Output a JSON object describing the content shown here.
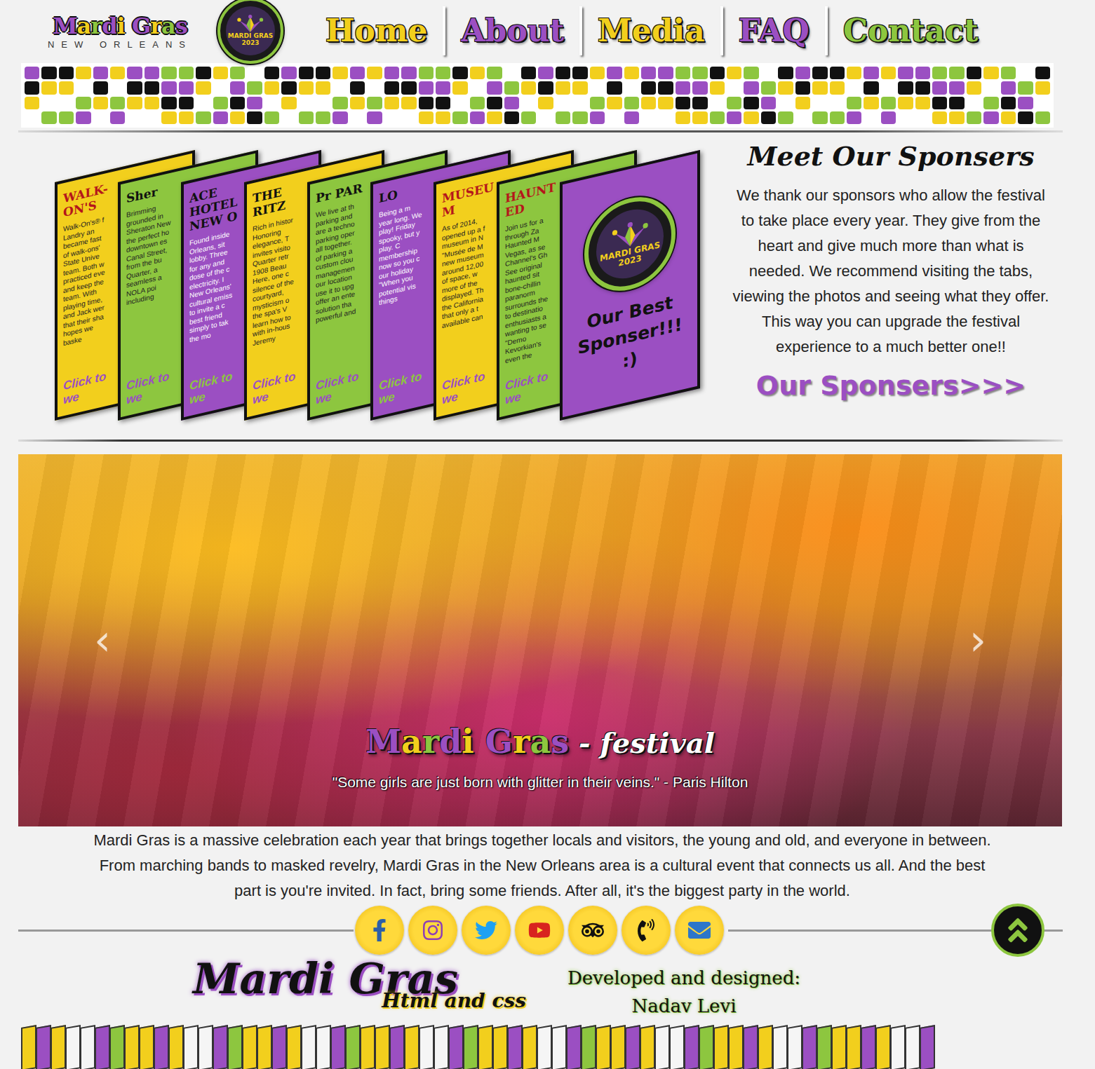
{
  "header": {
    "logo": {
      "title": "Mardi Gras",
      "subtitle": "NEW ORLEANS"
    },
    "badge": {
      "line1": "MARDI GRAS",
      "line2": "2023"
    },
    "nav": [
      {
        "label": "Home",
        "selected": false
      },
      {
        "label": "About",
        "selected": false
      },
      {
        "label": "Media",
        "selected": false
      },
      {
        "label": "FAQ",
        "selected": false
      },
      {
        "label": "Contact",
        "selected": false
      }
    ]
  },
  "sponsors": {
    "title": "Meet Our Sponsers",
    "description": "We thank our sponsors who allow the festival to take place every year. They give from the heart and give much more than what is needed. We recommend visiting the tabs, viewing the photos and seeing what they offer. This way you can upgrade the festival experience to a much better one!!",
    "link": "Our Sponsers>>>",
    "cards": [
      {
        "title": "WALK-ON'S",
        "color": "#f2cf1d",
        "lines": [
          "Walk-On's® f",
          "Landry an",
          "became fast",
          "of walk-ons'",
          "State Unive",
          "team. Both w",
          "practiced eve",
          "and keep the",
          "team. With",
          "playing time,",
          "and Jack wer",
          "that their sha",
          "hopes we",
          "baske"
        ],
        "cta": [
          "Click to",
          "we"
        ]
      },
      {
        "title": "Sher",
        "color": "#8dc63f",
        "lines": [
          "Brimming",
          "grounded in",
          "Sheraton New",
          "the perfect ho",
          "downtown es",
          "Canal Street,",
          "from the bu",
          "Quarter, a",
          "seamless a",
          "NOLA poi",
          "including"
        ],
        "cta": [
          "Click to",
          "we"
        ]
      },
      {
        "title": "ACE HOTEL NEW O",
        "color": "#9b4fc2",
        "lines": [
          "Found inside",
          "Orleans, sit",
          "lobby. Three",
          "for any and",
          "dose of the c",
          "electricity. I",
          "New Orleans'",
          "cultural emiss",
          "to invite a c",
          "best friend",
          "simply to tak",
          "the mo"
        ],
        "cta": [
          "Click to",
          "we"
        ]
      },
      {
        "title": "THE RITZ",
        "color": "#f2cf1d",
        "lines": [
          "Rich in histor",
          "Honoring",
          "elegance, T",
          "invites visito",
          "Quarter retr",
          "1908 Beau",
          "Here, one c",
          "silence of the",
          "courtyard,",
          "mysticism o",
          "the spa's V",
          "learn how to",
          "with in-hous",
          "Jeremy"
        ],
        "cta": [
          "Click to",
          "we"
        ]
      },
      {
        "title": "Pr PAR",
        "color": "#8dc63f",
        "lines": [
          "We live at th",
          "parking and",
          "are a techno",
          "parking oper",
          "all together.",
          "of parking a",
          "custom clou",
          "managemen",
          "our location",
          "use it to upg",
          "offer an ente",
          "solution tha",
          "powerful and"
        ],
        "cta": [
          "Click to",
          "we"
        ]
      },
      {
        "title": "LO",
        "color": "#9b4fc2",
        "lines": [
          "Being a m",
          "year long. We",
          "play! Friday",
          "spooky, but y",
          "play. C",
          "membership",
          "now so you c",
          "our holiday",
          "\"When you",
          "potential vis",
          "things"
        ],
        "cta": [
          "Click to",
          "we"
        ]
      },
      {
        "title": "MUSEUM",
        "color": "#f2cf1d",
        "lines": [
          "As of 2014,",
          "opened up a f",
          "museum in N",
          "\"Musée de M",
          "new museum",
          "around 12,00",
          "of space, w",
          "more of the",
          "displayed. Th",
          "the California",
          "that only a t",
          "available can"
        ],
        "cta": [
          "Click to",
          "we"
        ]
      },
      {
        "title": "HAUNTED",
        "color": "#8dc63f",
        "lines": [
          "Join us for a",
          "through Za",
          "Haunted M",
          "Vegas, as se",
          "Channel's Gh",
          "See original",
          "haunted sit",
          "bone-chillin",
          "paranorm",
          "surrounds the",
          "to destinatio",
          "enthusiasts a",
          "wanting to se",
          "\"Demo",
          "Kevorkian's",
          "even the"
        ],
        "cta": [
          "Click to",
          "we"
        ]
      }
    ],
    "best": {
      "badge": {
        "line1": "MARDI GRAS",
        "line2": "2023"
      },
      "label": "Our Best Sponser!!! :)",
      "color": "#9b4fc2"
    }
  },
  "carousel": {
    "title": "Mardi Gras",
    "subtitle": "- festival",
    "quote": "\"Some girls are just born with glitter in their veins.\" - Paris Hilton",
    "prev": "‹",
    "next": "›"
  },
  "intro": "Mardi Gras is a massive celebration each year that brings together locals and visitors, the young and old, and everyone in between. From marching bands to masked revelry, Mardi Gras in the New Orleans area is a cultural event that connects us all. And the best part is you're invited. In fact, bring some friends. After all, it's the biggest party in the world.",
  "footer": {
    "social": [
      {
        "kind": "facebook"
      },
      {
        "kind": "instagram"
      },
      {
        "kind": "twitter"
      },
      {
        "kind": "youtube"
      },
      {
        "kind": "tripadvisor"
      },
      {
        "kind": "phone"
      },
      {
        "kind": "email"
      }
    ],
    "credits": {
      "title": "Mardi Gras",
      "subtitle": "Html and css",
      "label": "Developed and designed:",
      "author": "Nadav Levi"
    }
  }
}
